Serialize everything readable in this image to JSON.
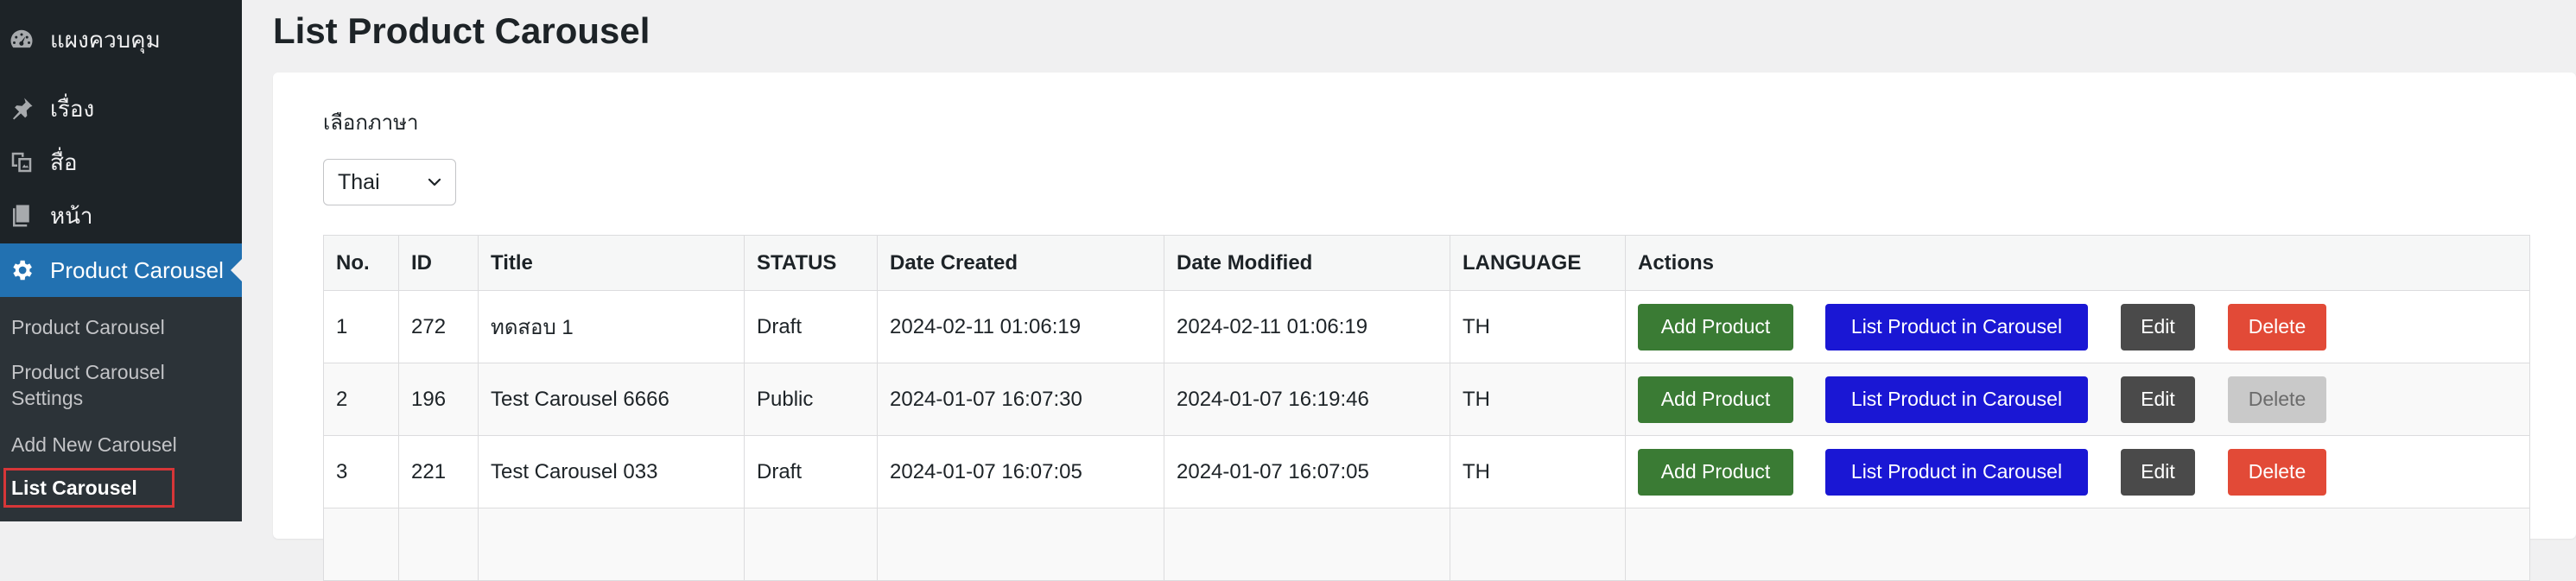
{
  "sidebar": {
    "items": [
      {
        "label": "แผงควบคุม",
        "icon": "dashboard-icon"
      },
      {
        "label": "เรื่อง",
        "icon": "pin-icon"
      },
      {
        "label": "สื่อ",
        "icon": "media-icon"
      },
      {
        "label": "หน้า",
        "icon": "page-icon"
      },
      {
        "label": "Product Carousel",
        "icon": "gear-icon",
        "active": true
      }
    ],
    "submenu": [
      {
        "label": "Product Carousel"
      },
      {
        "label_line1": "Product Carousel",
        "label_line2": "Settings"
      },
      {
        "label": "Add New Carousel"
      },
      {
        "label": "List Carousel",
        "current": true
      }
    ]
  },
  "page": {
    "title": "List Product Carousel"
  },
  "language": {
    "label": "เลือกภาษา",
    "selected": "Thai"
  },
  "table": {
    "headers": [
      "No.",
      "ID",
      "Title",
      "STATUS",
      "Date Created",
      "Date Modified",
      "LANGUAGE",
      "Actions"
    ],
    "rows": [
      {
        "no": "1",
        "id": "272",
        "title": "ทดสอบ 1",
        "status": "Draft",
        "created": "2024-02-11 01:06:19",
        "modified": "2024-02-11 01:06:19",
        "language": "TH",
        "delete_disabled": false
      },
      {
        "no": "2",
        "id": "196",
        "title": "Test Carousel 6666",
        "status": "Public",
        "created": "2024-01-07 16:07:30",
        "modified": "2024-01-07 16:19:46",
        "language": "TH",
        "delete_disabled": true
      },
      {
        "no": "3",
        "id": "221",
        "title": "Test Carousel 033",
        "status": "Draft",
        "created": "2024-01-07 16:07:05",
        "modified": "2024-01-07 16:07:05",
        "language": "TH",
        "delete_disabled": false
      }
    ],
    "actions": {
      "add_product": "Add Product",
      "list_product": "List Product in Carousel",
      "edit": "Edit",
      "delete": "Delete"
    }
  },
  "colors": {
    "sidebar_bg": "#1d2327",
    "active_bg": "#2271b1",
    "add_button": "#3a7b34",
    "list_button": "#1a17d4",
    "edit_button": "#4a4a4a",
    "delete_button": "#e24a37",
    "delete_disabled": "#c9c9c9"
  }
}
